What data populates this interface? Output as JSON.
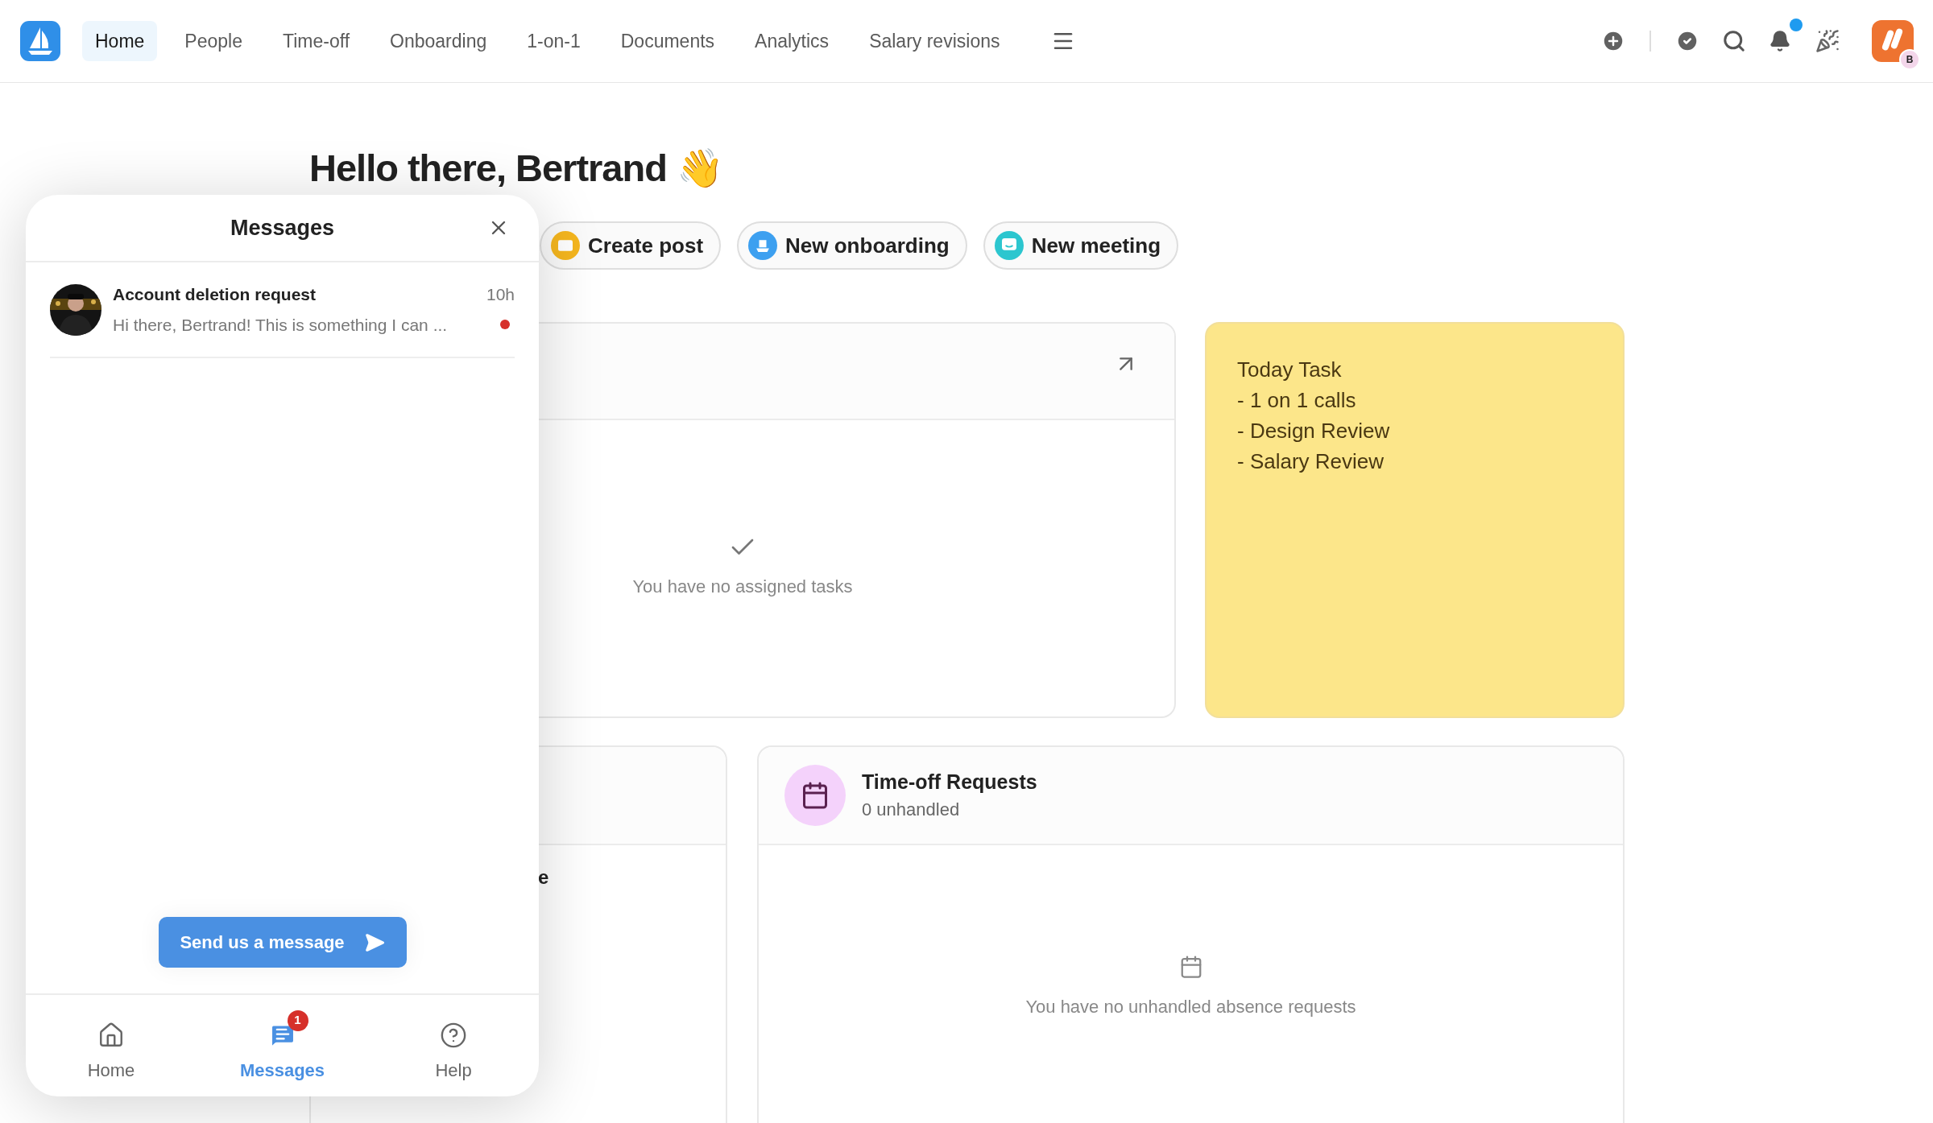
{
  "nav": {
    "tabs": [
      {
        "label": "Home",
        "selected": true
      },
      {
        "label": "People",
        "selected": false
      },
      {
        "label": "Time-off",
        "selected": false
      },
      {
        "label": "Onboarding",
        "selected": false
      },
      {
        "label": "1-on-1",
        "selected": false
      },
      {
        "label": "Documents",
        "selected": false
      },
      {
        "label": "Analytics",
        "selected": false
      },
      {
        "label": "Salary revisions",
        "selected": false
      }
    ],
    "notifications_unread": true,
    "user_initial": "B"
  },
  "greeting": "Hello there, Bertrand 👋",
  "quick_actions": [
    {
      "label": "Create post",
      "kind": "post",
      "color": "#f5b61e"
    },
    {
      "label": "New onboarding",
      "kind": "onboarding",
      "color": "#3da0f0"
    },
    {
      "label": "New meeting",
      "kind": "meeting",
      "color": "#2cc6cf"
    }
  ],
  "tasks_card": {
    "empty_text": "You have no assigned tasks"
  },
  "note": {
    "lines": [
      "Today Task",
      "- 1 on 1 calls",
      "- Design Review",
      "- Salary Review"
    ]
  },
  "left_card": {
    "fragment": "e"
  },
  "timeoff_card": {
    "title": "Time-off Requests",
    "subtitle": "0 unhandled",
    "empty_text": "You have no unhandled absence requests"
  },
  "messages_panel": {
    "title": "Messages",
    "conversations": [
      {
        "title": "Account deletion request",
        "time": "10h",
        "preview": "Hi there, Bertrand! This is something I can ...",
        "unread": true
      }
    ],
    "send_button": "Send us a message",
    "tabs": [
      {
        "label": "Home",
        "kind": "home",
        "selected": false
      },
      {
        "label": "Messages",
        "kind": "messages",
        "selected": true,
        "badge": "1"
      },
      {
        "label": "Help",
        "kind": "help",
        "selected": false
      }
    ]
  }
}
